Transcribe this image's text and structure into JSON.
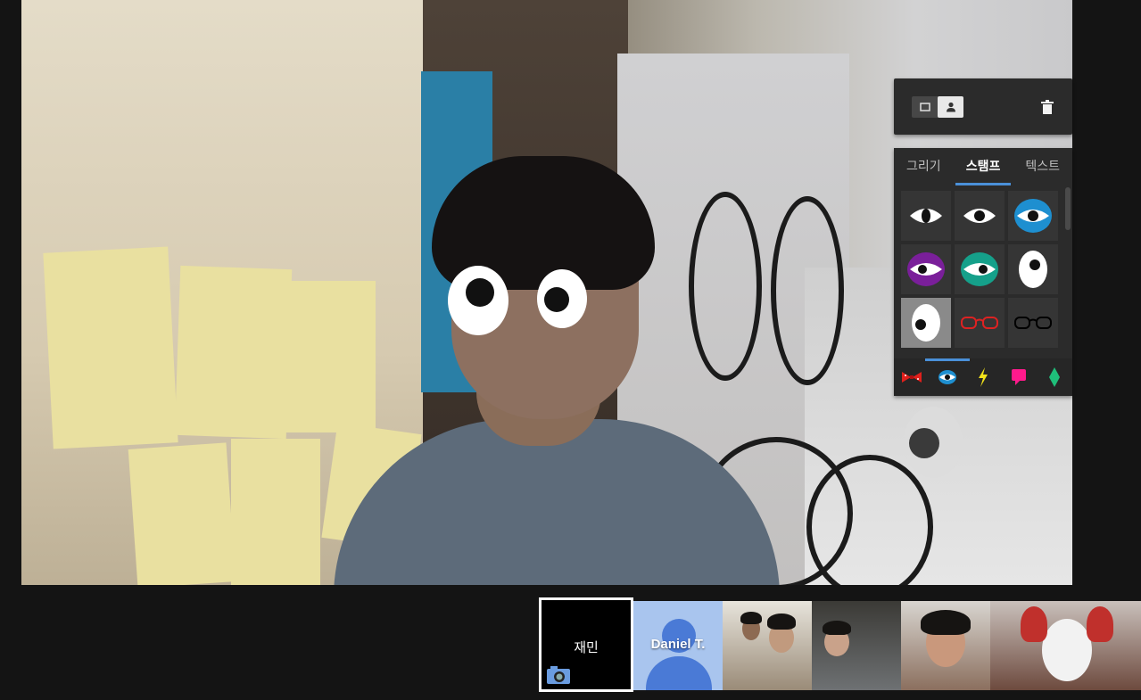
{
  "toolbar": {
    "mode_icons": [
      "rectangle-icon",
      "person-icon"
    ],
    "active_mode": "person-icon",
    "trash_icon": "trash-icon"
  },
  "stamp_panel": {
    "tabs": [
      {
        "label": "그리기",
        "active": false
      },
      {
        "label": "스탬프",
        "active": true
      },
      {
        "label": "텍스트",
        "active": false
      }
    ],
    "stamps": [
      "eye-almond-icon",
      "eye-round-icon",
      "eye-blue-icon",
      "eye-purple-icon",
      "eye-green-icon",
      "eye-tall-icon",
      "eye-googly-icon",
      "red-glasses-icon",
      "black-glasses-icon"
    ],
    "selected_stamp": "eye-googly-icon",
    "categories": [
      "bowtie-icon",
      "eye-icon",
      "lightning-icon",
      "speech-bubble-icon",
      "gem-icon"
    ],
    "active_category": "eye-icon"
  },
  "filmstrip": {
    "participants": [
      {
        "name": "재민",
        "self": true
      },
      {
        "name": "Daniel T.",
        "self": false
      },
      {
        "name": "",
        "self": false
      },
      {
        "name": "",
        "self": false
      },
      {
        "name": "",
        "self": false
      }
    ]
  },
  "colors": {
    "background": "#141414",
    "panel": "#2b2b2b",
    "accent": "#4a90d9"
  }
}
